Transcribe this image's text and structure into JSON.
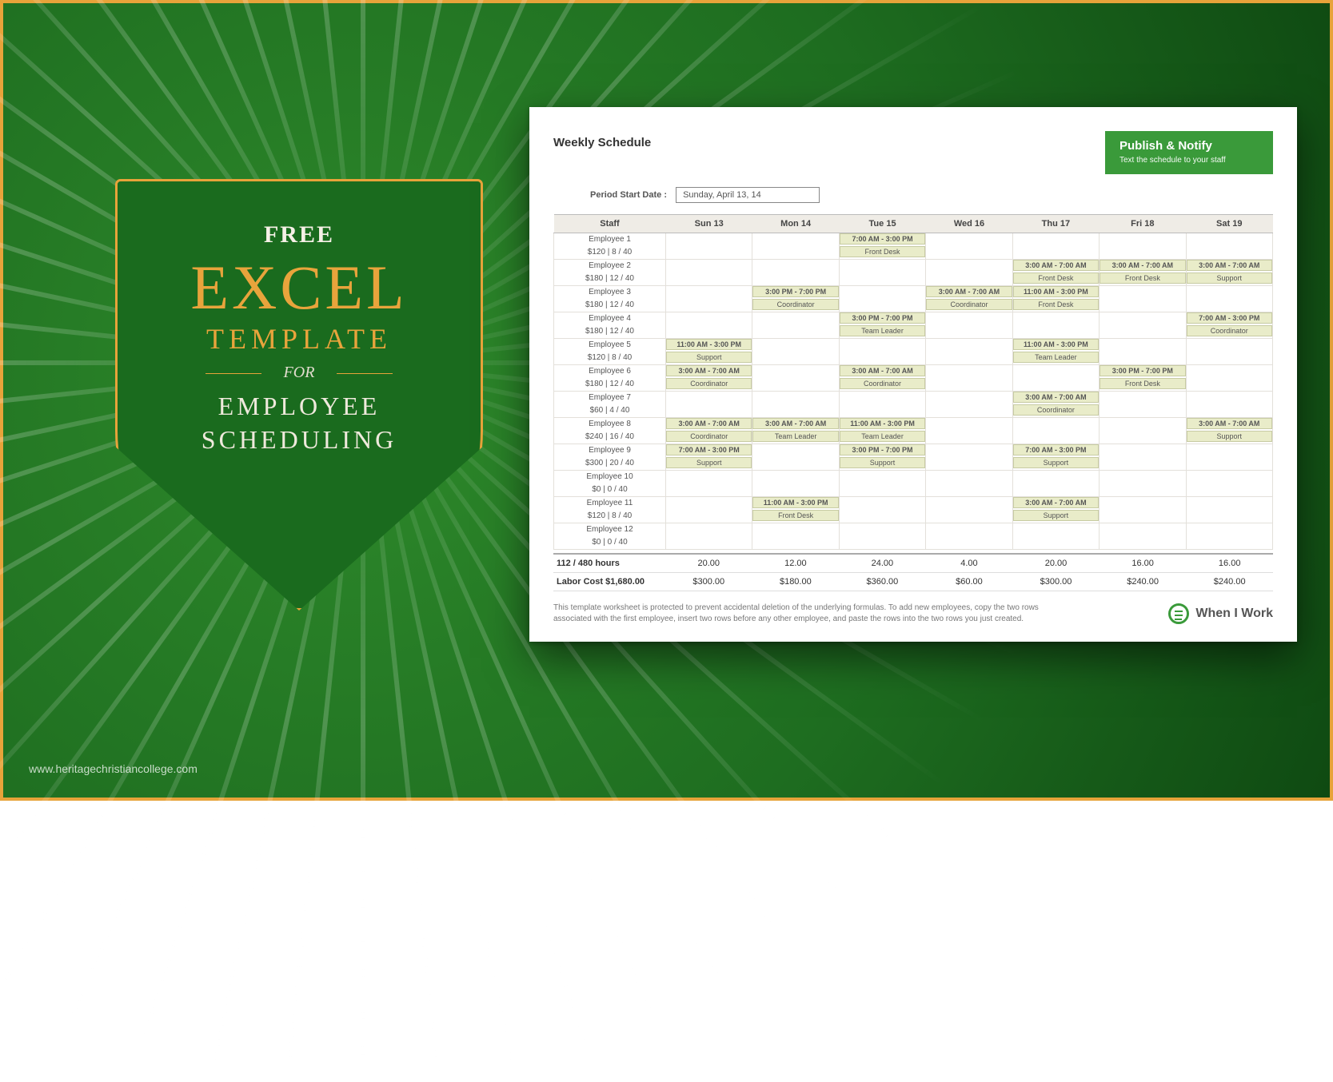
{
  "badge": {
    "free": "FREE",
    "excel": "EXCEL",
    "template": "TEMPLATE",
    "for": "FOR",
    "line1": "EMPLOYEE",
    "line2": "SCHEDULING"
  },
  "watermark": "www.heritagechristiancollege.com",
  "sheet": {
    "title": "Weekly Schedule",
    "period_label": "Period Start Date :",
    "period_value": "Sunday, April 13, 14",
    "publish_title": "Publish & Notify",
    "publish_sub": "Text the schedule to your staff",
    "days": [
      "Sun 13",
      "Mon 14",
      "Tue 15",
      "Wed 16",
      "Thu 17",
      "Fri 18",
      "Sat 19"
    ],
    "staff_header": "Staff",
    "employees": [
      {
        "name": "Employee 1",
        "meta": "$120 | 8 / 40",
        "shifts": [
          null,
          null,
          {
            "t": "7:00 AM - 3:00 PM",
            "r": "Front Desk"
          },
          null,
          null,
          null,
          null
        ]
      },
      {
        "name": "Employee 2",
        "meta": "$180 | 12 / 40",
        "shifts": [
          null,
          null,
          null,
          null,
          {
            "t": "3:00 AM - 7:00 AM",
            "r": "Front Desk"
          },
          {
            "t": "3:00 AM - 7:00 AM",
            "r": "Front Desk"
          },
          {
            "t": "3:00 AM - 7:00 AM",
            "r": "Support"
          }
        ]
      },
      {
        "name": "Employee 3",
        "meta": "$180 | 12 / 40",
        "shifts": [
          null,
          {
            "t": "3:00 PM - 7:00 PM",
            "r": "Coordinator"
          },
          null,
          {
            "t": "3:00 AM - 7:00 AM",
            "r": "Coordinator"
          },
          {
            "t": "11:00 AM - 3:00 PM",
            "r": "Front Desk"
          },
          null,
          null
        ]
      },
      {
        "name": "Employee 4",
        "meta": "$180 | 12 / 40",
        "shifts": [
          null,
          null,
          {
            "t": "3:00 PM - 7:00 PM",
            "r": "Team Leader"
          },
          null,
          null,
          null,
          {
            "t": "7:00 AM - 3:00 PM",
            "r": "Coordinator"
          }
        ]
      },
      {
        "name": "Employee 5",
        "meta": "$120 | 8 / 40",
        "shifts": [
          {
            "t": "11:00 AM - 3:00 PM",
            "r": "Support"
          },
          null,
          null,
          null,
          {
            "t": "11:00 AM - 3:00 PM",
            "r": "Team Leader"
          },
          null,
          null
        ]
      },
      {
        "name": "Employee 6",
        "meta": "$180 | 12 / 40",
        "shifts": [
          {
            "t": "3:00 AM - 7:00 AM",
            "r": "Coordinator"
          },
          null,
          {
            "t": "3:00 AM - 7:00 AM",
            "r": "Coordinator"
          },
          null,
          null,
          {
            "t": "3:00 PM - 7:00 PM",
            "r": "Front Desk"
          },
          null
        ]
      },
      {
        "name": "Employee 7",
        "meta": "$60 | 4 / 40",
        "shifts": [
          null,
          null,
          null,
          null,
          {
            "t": "3:00 AM - 7:00 AM",
            "r": "Coordinator"
          },
          null,
          null
        ]
      },
      {
        "name": "Employee 8",
        "meta": "$240 | 16 / 40",
        "shifts": [
          {
            "t": "3:00 AM - 7:00 AM",
            "r": "Coordinator"
          },
          {
            "t": "3:00 AM - 7:00 AM",
            "r": "Team Leader"
          },
          {
            "t": "11:00 AM - 3:00 PM",
            "r": "Team Leader"
          },
          null,
          null,
          null,
          {
            "t": "3:00 AM - 7:00 AM",
            "r": "Support"
          }
        ]
      },
      {
        "name": "Employee 9",
        "meta": "$300 | 20 / 40",
        "shifts": [
          {
            "t": "7:00 AM - 3:00 PM",
            "r": "Support"
          },
          null,
          {
            "t": "3:00 PM - 7:00 PM",
            "r": "Support"
          },
          null,
          {
            "t": "7:00 AM - 3:00 PM",
            "r": "Support"
          },
          null,
          null
        ]
      },
      {
        "name": "Employee 10",
        "meta": "$0 | 0 / 40",
        "shifts": [
          null,
          null,
          null,
          null,
          null,
          null,
          null
        ]
      },
      {
        "name": "Employee 11",
        "meta": "$120 | 8 / 40",
        "shifts": [
          null,
          {
            "t": "11:00 AM - 3:00 PM",
            "r": "Front Desk"
          },
          null,
          null,
          {
            "t": "3:00 AM - 7:00 AM",
            "r": "Support"
          },
          null,
          null
        ]
      },
      {
        "name": "Employee 12",
        "meta": "$0 | 0 / 40",
        "shifts": [
          null,
          null,
          null,
          null,
          null,
          null,
          null
        ]
      }
    ],
    "summary": {
      "hours_label": "112 / 480 hours",
      "hours": [
        "20.00",
        "12.00",
        "24.00",
        "4.00",
        "20.00",
        "16.00",
        "16.00"
      ],
      "cost_label": "Labor Cost $1,680.00",
      "costs": [
        "$300.00",
        "$180.00",
        "$360.00",
        "$60.00",
        "$300.00",
        "$240.00",
        "$240.00"
      ]
    },
    "footnote": "This template worksheet is protected to prevent accidental deletion of the underlying formulas. To add new employees, copy the two rows associated with the first employee, insert two rows before any other employee, and paste the rows into the two rows you just created.",
    "brand": "When I Work"
  }
}
